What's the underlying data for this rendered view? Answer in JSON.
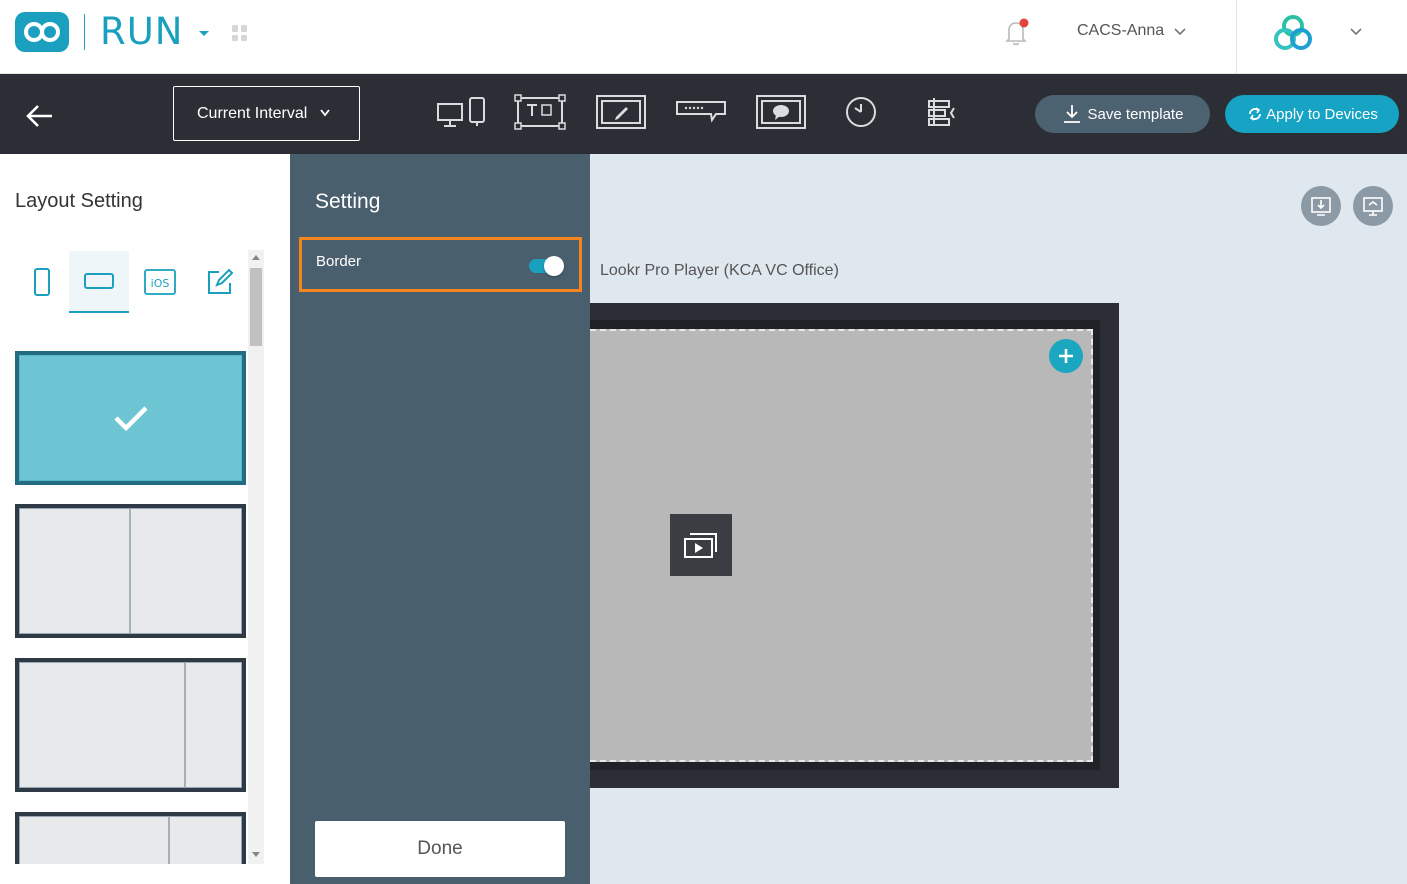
{
  "header": {
    "brand": "RUN",
    "user_name": "CACS-Anna"
  },
  "toolbar": {
    "interval_label": "Current Interval",
    "save_label": "Save template",
    "apply_label": "Apply to Devices",
    "tools": [
      "device-toggle-icon",
      "text-qr-widget-icon",
      "edit-widget-icon",
      "ticker-widget-icon",
      "message-widget-icon",
      "clock-widget-icon",
      "layer-align-icon"
    ]
  },
  "left_panel": {
    "title": "Layout Setting",
    "orientation_tabs": [
      "portrait",
      "landscape",
      "ios",
      "custom-edit"
    ],
    "active_tab": "landscape",
    "layouts": [
      {
        "type": "full",
        "selected": true
      },
      {
        "type": "split-half",
        "selected": false
      },
      {
        "type": "split-three-quarter",
        "selected": false
      },
      {
        "type": "split-partial",
        "selected": false
      }
    ]
  },
  "setting_panel": {
    "title": "Setting",
    "border_label": "Border",
    "border_enabled": true,
    "done_label": "Done"
  },
  "canvas": {
    "device_name": "Lookr Pro Player (KCA VC Office)"
  },
  "colors": {
    "brand": "#1aa0be",
    "toolbar_bg": "#2b2f35",
    "setting_bg": "#4a5f6d",
    "highlight": "#f5841f",
    "apply_bg": "#16a3c4",
    "save_bg": "#4d6270",
    "canvas_bg": "#e0e8ef"
  }
}
